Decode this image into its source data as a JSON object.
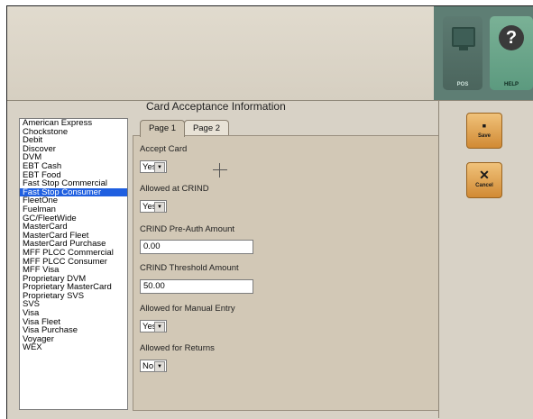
{
  "toolbar": {
    "pos_label": "POS",
    "help_label": "HELP",
    "help_glyph": "?"
  },
  "title": "Card Acceptance Information",
  "tabs": [
    "Page 1",
    "Page 2"
  ],
  "cards": [
    "American Express",
    "Chockstone",
    "Debit",
    "Discover",
    "DVM",
    "EBT Cash",
    "EBT Food",
    "Fast Stop Commercial",
    "Fast Stop Consumer",
    "FleetOne",
    "Fuelman",
    "GC/FleetWide",
    "MasterCard",
    "MasterCard Fleet",
    "MasterCard Purchase",
    "MFF PLCC Commercial",
    "MFF PLCC Consumer",
    "MFF Visa",
    "Proprietary DVM",
    "Proprietary MasterCard",
    "Proprietary SVS",
    "SVS",
    "Visa",
    "Visa Fleet",
    "Visa Purchase",
    "Voyager",
    "WEX"
  ],
  "selected_card": "Fast Stop Consumer",
  "fields": {
    "accept_card_label": "Accept Card",
    "accept_card_value": "Yes",
    "allowed_crind_label": "Allowed at CRIND",
    "allowed_crind_value": "Yes",
    "preauth_label": "CRIND Pre-Auth Amount",
    "preauth_value": "0.00",
    "threshold_label": "CRIND Threshold Amount",
    "threshold_value": "50.00",
    "manual_label": "Allowed for Manual Entry",
    "manual_value": "Yes",
    "returns_label": "Allowed for Returns",
    "returns_value": "No"
  },
  "actions": {
    "save_label": "Save",
    "cancel_label": "Cancel"
  },
  "colors": {
    "selection": "#1f5fe0",
    "action_button": "#e3a150",
    "toolbar_bg": "#5e7e74"
  }
}
